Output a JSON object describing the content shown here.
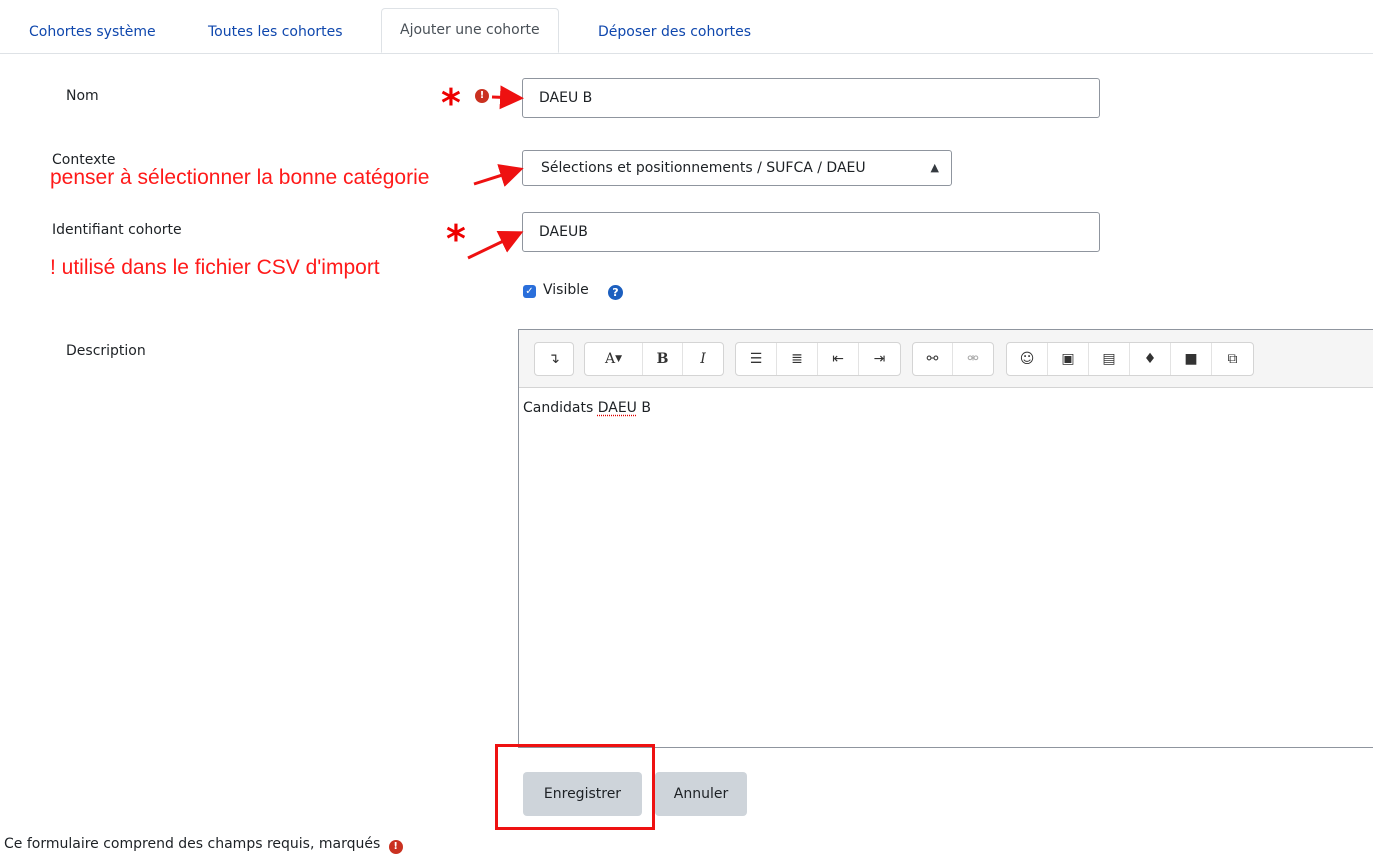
{
  "tabs": [
    {
      "label": "Cohortes système"
    },
    {
      "label": "Toutes les cohortes"
    },
    {
      "label": "Ajouter une cohorte",
      "active": true
    },
    {
      "label": "Déposer des cohortes"
    }
  ],
  "form": {
    "name": {
      "label": "Nom",
      "value": "DAEU B"
    },
    "context": {
      "label": "Contexte",
      "value": "Sélections et positionnements / SUFCA / DAEU"
    },
    "idnumber": {
      "label": "Identifiant cohorte",
      "value": "DAEUB"
    },
    "visible": {
      "label": "Visible",
      "checked": true
    },
    "description": {
      "label": "Description",
      "content_prefix": "Candidats ",
      "content_flagged": "DAEU",
      "content_suffix": " B"
    }
  },
  "annotations": {
    "context_note": "penser à sélectionner la bonne catégorie",
    "idnumber_note": "! utilisé dans le fichier CSV d'import",
    "star": "*"
  },
  "buttons": {
    "save": "Enregistrer",
    "cancel": "Annuler"
  },
  "footer": {
    "text": "Ce formulaire comprend des champs requis, marqués"
  },
  "colors": {
    "link": "#0f47ad",
    "annotation": "#ff1a1a",
    "required": "#ca3120"
  }
}
